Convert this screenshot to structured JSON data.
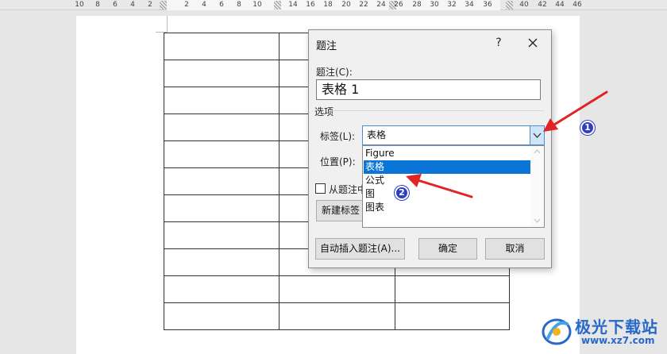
{
  "ruler": {
    "left_ticks": [
      "10",
      "8",
      "6",
      "4",
      "2"
    ],
    "mid_ticks": [
      "2",
      "4",
      "6",
      "8",
      "10"
    ],
    "right_ticks": [
      "14",
      "16",
      "18",
      "20",
      "22",
      "24"
    ],
    "far_ticks": [
      "26",
      "28",
      "30",
      "32",
      "34",
      "36"
    ],
    "end_ticks": [
      "40",
      "42",
      "44",
      "46"
    ]
  },
  "dialog": {
    "title": "题注",
    "help_label": "?",
    "caption_label": "题注(C):",
    "caption_value": "表格 1",
    "options_heading": "选项",
    "label_field_label": "标签(L):",
    "label_value": "表格",
    "dropdown_options": [
      "Figure",
      "表格",
      "公式",
      "图",
      "图表"
    ],
    "selected_option": "表格",
    "position_label": "位置(P):",
    "exclude_label_checkbox": "从题注中",
    "new_label_button": "新建标签",
    "autocaption_button": "自动插入题注(A)...",
    "ok_button": "确定",
    "cancel_button": "取消"
  },
  "annotations": {
    "badge_1": "1",
    "badge_2": "2",
    "arrow_color": "#e02424"
  },
  "watermark": {
    "name": "极光下载站",
    "url": "www.xz7.com"
  },
  "colors": {
    "selection": "#0a75d6",
    "badge": "#2f3fbf",
    "watermark": "#2868c9"
  }
}
